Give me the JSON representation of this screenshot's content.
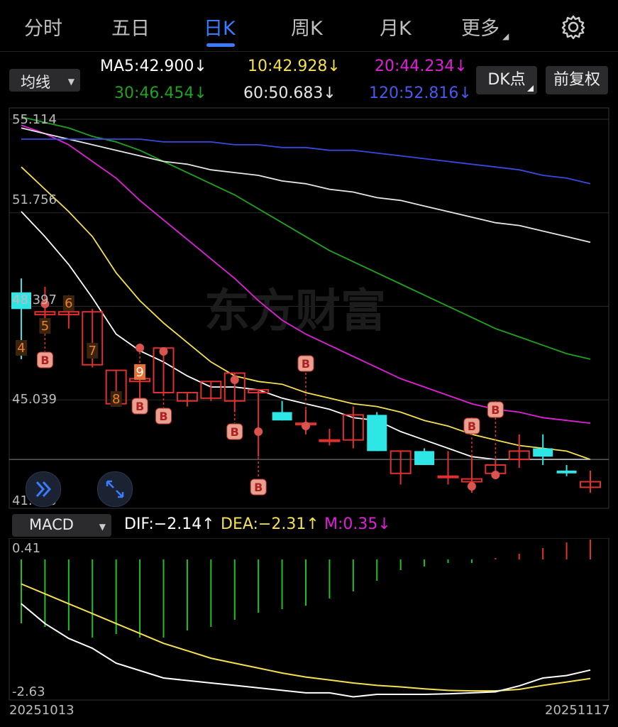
{
  "tabs": [
    {
      "label": "分时"
    },
    {
      "label": "五日"
    },
    {
      "label": "日K"
    },
    {
      "label": "周K"
    },
    {
      "label": "月K"
    },
    {
      "label": "更多"
    }
  ],
  "active_tab": "日K",
  "icons": {
    "settings": "gear-icon",
    "more": "caret-down-icon"
  },
  "ma_selector": {
    "label": "均线"
  },
  "ma_values": {
    "ma5": "MA5:42.900",
    "ma10": "10:42.928",
    "ma20": "20:44.234",
    "ma30": "30:46.454",
    "ma60": "60:50.683",
    "ma120": "120:52.816",
    "arrow": "↓"
  },
  "colors": {
    "ma5": "#ffffff",
    "ma10": "#f5e050",
    "ma20": "#e020d8",
    "ma30": "#1fa31f",
    "ma60": "#e6e6e6",
    "ma120": "#3848e0",
    "up": "#e03030",
    "down": "#2ee6e6",
    "accent": "#3a7bff"
  },
  "dk_button": "DK点",
  "fq_button": "前复权",
  "price_axis": [
    "55.114",
    "51.756",
    "48.397",
    "45.039",
    "41.680"
  ],
  "watermark": "东方财富",
  "macd_selector": {
    "label": "MACD"
  },
  "macd_values": {
    "dif": "DIF:−2.14",
    "dea": "DEA:−2.31",
    "m": "M:0.35",
    "up_arrow": "↑",
    "down_arrow": "↓"
  },
  "macd_axis": [
    "0.41",
    "-2.63"
  ],
  "dates": {
    "start": "20251013",
    "end": "20251117"
  },
  "signals": {
    "b_label": "B",
    "numbers": [
      "4",
      "5",
      "6",
      "7",
      "8",
      "9"
    ]
  },
  "chart_data": {
    "type": "candlestick",
    "x_range": [
      "20251013",
      "20251117"
    ],
    "ylim": [
      41.68,
      55.114
    ],
    "candles_ohlc": [
      [
        48.9,
        49.4,
        46.5,
        48.3
      ],
      [
        48.1,
        49.1,
        47.4,
        48.2
      ],
      [
        48.1,
        48.8,
        47.6,
        48.2
      ],
      [
        46.3,
        48.3,
        46.2,
        48.2
      ],
      [
        44.9,
        46.1,
        44.8,
        46.1
      ],
      [
        45.7,
        46.0,
        45.0,
        45.8
      ],
      [
        45.3,
        46.9,
        45.2,
        46.9
      ],
      [
        45.0,
        45.3,
        44.8,
        45.3
      ],
      [
        45.1,
        45.7,
        45.0,
        45.7
      ],
      [
        45.0,
        46.0,
        44.6,
        46.0
      ],
      [
        45.3,
        45.4,
        43.0,
        45.4
      ],
      [
        44.6,
        45.0,
        44.3,
        44.3
      ],
      [
        44.2,
        44.7,
        43.8,
        44.2
      ],
      [
        43.6,
        44.0,
        43.4,
        43.6
      ],
      [
        43.6,
        44.8,
        43.3,
        44.5
      ],
      [
        44.5,
        44.6,
        43.2,
        43.2
      ],
      [
        42.4,
        43.2,
        42.0,
        43.2
      ],
      [
        43.2,
        43.3,
        42.7,
        42.7
      ],
      [
        42.3,
        43.2,
        42.0,
        42.3
      ],
      [
        42.1,
        43.0,
        41.7,
        42.2
      ],
      [
        42.4,
        42.9,
        42.3,
        42.7
      ],
      [
        42.9,
        43.8,
        42.6,
        43.2
      ],
      [
        43.3,
        43.8,
        42.7,
        43.0
      ],
      [
        42.5,
        42.7,
        42.3,
        42.4
      ],
      [
        41.9,
        42.5,
        41.7,
        42.1
      ]
    ],
    "ma_series": {
      "MA5": [
        51.8,
        50.9,
        49.9,
        48.7,
        47.4,
        46.8,
        46.4,
        45.9,
        45.5,
        45.5,
        45.4,
        45.1,
        44.9,
        44.7,
        44.4,
        44.3,
        43.9,
        43.6,
        43.3,
        43.0,
        42.9,
        42.9,
        42.9,
        42.9,
        42.9
      ],
      "MA10": [
        53.4,
        52.6,
        51.8,
        50.9,
        49.6,
        48.6,
        47.8,
        47.1,
        46.4,
        45.9,
        45.7,
        45.6,
        45.3,
        45.1,
        44.9,
        44.8,
        44.6,
        44.3,
        44.1,
        43.8,
        43.6,
        43.4,
        43.3,
        43.2,
        42.9
      ],
      "MA20": [
        54.9,
        54.6,
        54.2,
        53.6,
        53.0,
        52.2,
        51.5,
        50.8,
        50.1,
        49.4,
        48.6,
        47.9,
        47.4,
        47.0,
        46.6,
        46.2,
        45.8,
        45.5,
        45.2,
        44.9,
        44.7,
        44.6,
        44.4,
        44.3,
        44.2
      ],
      "MA30": [
        55.2,
        55.0,
        54.8,
        54.5,
        54.3,
        54.0,
        53.6,
        53.2,
        52.8,
        52.4,
        51.9,
        51.4,
        50.9,
        50.4,
        50.0,
        49.6,
        49.2,
        48.8,
        48.4,
        48.0,
        47.6,
        47.3,
        47.0,
        46.7,
        46.5
      ],
      "MA60": [
        54.8,
        54.6,
        54.4,
        54.2,
        54.0,
        53.8,
        53.6,
        53.5,
        53.3,
        53.2,
        53.1,
        52.9,
        52.8,
        52.6,
        52.5,
        52.3,
        52.2,
        52.0,
        51.8,
        51.6,
        51.4,
        51.3,
        51.1,
        50.9,
        50.7
      ],
      "MA120": [
        54.4,
        54.4,
        54.4,
        54.4,
        54.4,
        54.4,
        54.3,
        54.3,
        54.3,
        54.2,
        54.2,
        54.1,
        54.1,
        54.0,
        54.0,
        53.9,
        53.8,
        53.7,
        53.6,
        53.5,
        53.4,
        53.3,
        53.1,
        53.0,
        52.8
      ]
    },
    "macd": {
      "ylim": [
        -2.63,
        0.41
      ],
      "hist": [
        -0.9,
        -0.95,
        -1.0,
        -1.1,
        -1.05,
        -1.1,
        -1.1,
        -1.0,
        -0.95,
        -0.85,
        -0.75,
        -0.7,
        -0.65,
        -0.55,
        -0.45,
        -0.3,
        -0.15,
        -0.1,
        -0.05,
        -0.05,
        0.0,
        0.1,
        0.2,
        0.3,
        0.35
      ],
      "dif": [
        -0.8,
        -1.2,
        -1.5,
        -1.7,
        -2.0,
        -2.15,
        -2.3,
        -2.35,
        -2.4,
        -2.45,
        -2.5,
        -2.55,
        -2.6,
        -2.6,
        -2.68,
        -2.63,
        -2.63,
        -2.63,
        -2.62,
        -2.6,
        -2.58,
        -2.46,
        -2.3,
        -2.25,
        -2.14
      ],
      "dea": [
        -0.4,
        -0.6,
        -0.8,
        -1.0,
        -1.2,
        -1.4,
        -1.6,
        -1.75,
        -1.9,
        -2.0,
        -2.1,
        -2.2,
        -2.28,
        -2.34,
        -2.4,
        -2.45,
        -2.48,
        -2.52,
        -2.55,
        -2.56,
        -2.56,
        -2.53,
        -2.45,
        -2.38,
        -2.31
      ]
    }
  }
}
